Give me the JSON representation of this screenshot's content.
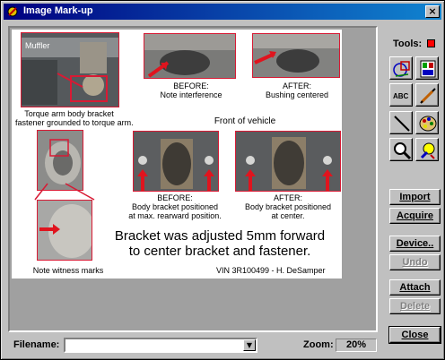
{
  "window": {
    "title": "Image Mark-up",
    "close_glyph": "×"
  },
  "tools_panel": {
    "label": "Tools:",
    "active_color": "#ff0000",
    "tools": [
      "shapes-tool-icon",
      "frame-tool-icon",
      "text-tool-icon",
      "pen-tool-icon",
      "line-tool-icon",
      "palette-tool-icon",
      "zoom-tool-icon",
      "highlight-tool-icon"
    ],
    "text_tool_glyph": "ABC"
  },
  "buttons": {
    "import": "Import",
    "acquire": "Acquire",
    "device": "Device..",
    "undo": "Undo",
    "attach": "Attach",
    "delete": "Delete",
    "close": "Close"
  },
  "filename": {
    "label": "Filename:",
    "value": ""
  },
  "zoom": {
    "label": "Zoom:",
    "value": "20%"
  },
  "image": {
    "muffler_label": "Muffler",
    "caption_torque": [
      "Torque arm body bracket",
      "fastener grounded to torque arm."
    ],
    "caption_before_top": [
      "BEFORE:",
      "Note interference"
    ],
    "caption_after_top": [
      "AFTER:",
      "Bushing centered"
    ],
    "front_label": "Front of vehicle",
    "caption_before_mid": [
      "BEFORE:",
      "Body bracket positioned",
      "at max. rearward position."
    ],
    "caption_after_mid": [
      "AFTER:",
      "Body bracket positioned",
      "at center."
    ],
    "headline": [
      "Bracket was adjusted 5mm forward",
      "to center bracket and fastener."
    ],
    "witness": "Note witness marks",
    "vin": "VIN 3R100499 - H. DeSamper"
  }
}
